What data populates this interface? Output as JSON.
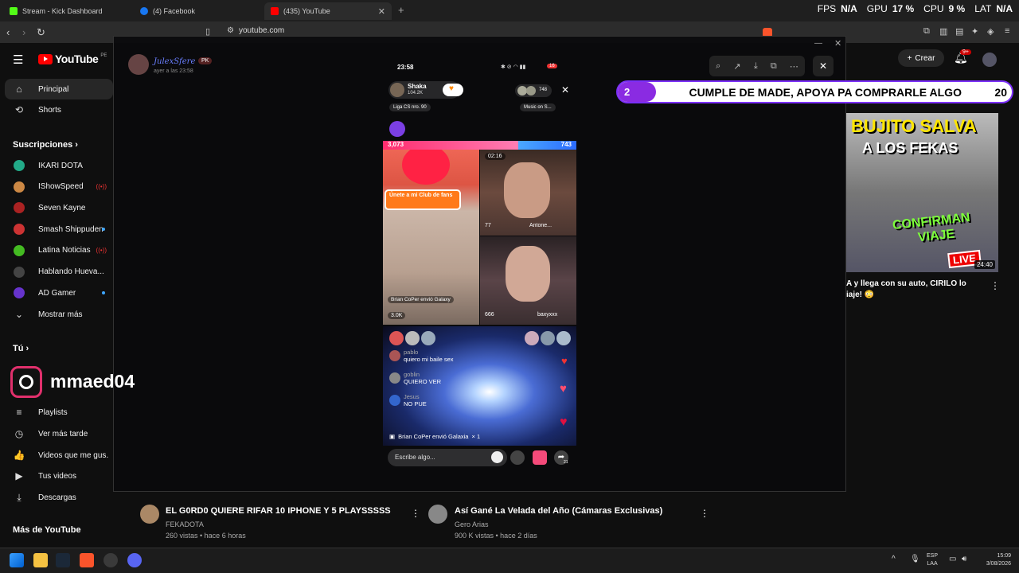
{
  "browser": {
    "tabs": [
      {
        "label": "Stream - Kick Dashboard",
        "color": "#53fc18"
      },
      {
        "label": "(4) Facebook",
        "color": "#1877f2"
      },
      {
        "label": "(435) YouTube",
        "color": "#ff0000"
      }
    ],
    "url": "youtube.com",
    "stats": {
      "fps_label": "FPS",
      "fps_val": "N/A",
      "gpu_label": "GPU",
      "gpu_val": "17 %",
      "cpu_label": "CPU",
      "cpu_val": "9 %",
      "lat_label": "LAT",
      "lat_val": "N/A"
    }
  },
  "youtube": {
    "logo": "YouTube",
    "country": "PE",
    "create_label": "Crear",
    "notif_badge": "9+",
    "nav": [
      {
        "label": "Principal",
        "icon": "home-icon"
      },
      {
        "label": "Shorts",
        "icon": "shorts-icon"
      }
    ],
    "subs_header": "Suscripciones",
    "subs": [
      {
        "label": "IKARI DOTA",
        "color": "#2a8",
        "mark": ""
      },
      {
        "label": "IShowSpeed",
        "color": "#c84",
        "mark": "live"
      },
      {
        "label": "Seven Kayne",
        "color": "#a22",
        "mark": ""
      },
      {
        "label": "Smash Shippuden",
        "color": "#c33",
        "mark": "dot"
      },
      {
        "label": "Latina Noticias",
        "color": "#4b2",
        "mark": "live"
      },
      {
        "label": "Hablando Hueva...",
        "color": "#444",
        "mark": ""
      },
      {
        "label": "AD Gamer",
        "color": "#63c",
        "mark": "dot"
      }
    ],
    "show_more": "Mostrar más",
    "you_header": "Tú",
    "you_items": [
      {
        "label": "Playlists",
        "icon": "playlists-icon"
      },
      {
        "label": "Ver más tarde",
        "icon": "clock-icon"
      },
      {
        "label": "Videos que me gus...",
        "icon": "thumbs-up-icon"
      },
      {
        "label": "Tus videos",
        "icon": "video-icon"
      },
      {
        "label": "Descargas",
        "icon": "download-icon"
      }
    ],
    "more_header": "Más de YouTube",
    "videos": [
      {
        "title": "EL G0RD0 QUIERE RIFAR 10 IPHONE Y 5 PLAYSSSSS",
        "channel": "FEKADOTA",
        "meta": "260 vistas • hace 6 horas"
      },
      {
        "title": "Así Gané La Velada del Año (Cámaras Exclusivas)",
        "channel": "Gero Arias",
        "meta": "900 K vistas • hace 2 días"
      }
    ],
    "side_video": {
      "thumb_line1": "BUJITO SALVA",
      "thumb_line2": "A LOS FEKAS",
      "thumb_line3": "CONFIRMAN",
      "thumb_line4": "VIAJE",
      "live": "LIVE",
      "duration": "24:40",
      "title_1": "A y llega con su auto, CIRILO lo",
      "title_2": "iaje! 😳"
    }
  },
  "modal": {
    "user": "JulexSfere",
    "user_tag": "PK",
    "time": "ayer a las 23:58"
  },
  "phone": {
    "clock": "23:58",
    "battery": "16",
    "host": "Shaka",
    "host_likes": "104.2K",
    "viewers": "748",
    "liga": "Liga CS nro. 90",
    "music": "Music on S...",
    "score_left": "3,073",
    "score_right": "743",
    "timer": "02:16",
    "club": "Únete a mi Club de fans",
    "tiles": [
      {
        "name": "Brian CoPer envió Galaxy",
        "count": "3.0K"
      },
      {
        "name": "Antone...",
        "count": "77"
      },
      {
        "name": "baxyxxx",
        "count": "666"
      }
    ],
    "chat": [
      {
        "user": "pablo",
        "msg": "quiero mi baile sex"
      },
      {
        "user": "goblin",
        "msg": "QUIERO VER"
      },
      {
        "user": "Jesus",
        "msg": "NO PUE"
      }
    ],
    "gift_line": "Brian CoPer envió Galaxia",
    "gift_count": "× 1",
    "input_placeholder": "Escribe algo...",
    "share_count": "21"
  },
  "banner": {
    "left": "2",
    "text": "CUMPLE DE MADE, APOYA PA COMPRARLE ALGO",
    "right": "20"
  },
  "instagram": {
    "handle": "mmaed04"
  },
  "taskbar": {
    "lang1": "ESP",
    "lang2": "LAA",
    "time": "15:09",
    "date": "3/08/2026"
  }
}
